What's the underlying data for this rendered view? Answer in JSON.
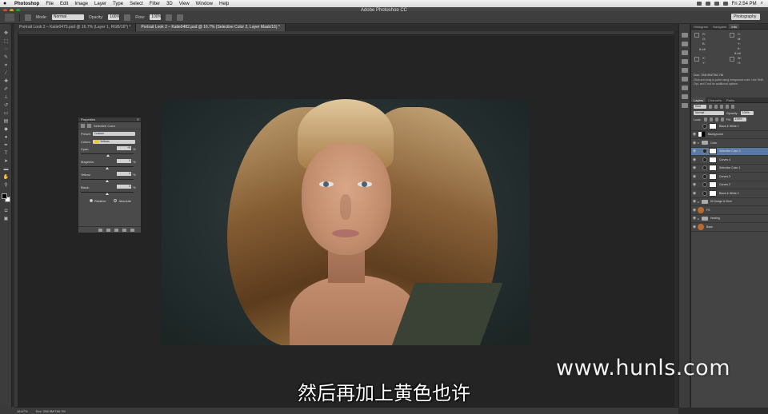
{
  "menubar": {
    "app_name": "Photoshop",
    "menus": [
      "File",
      "Edit",
      "Image",
      "Layer",
      "Type",
      "Select",
      "Filter",
      "3D",
      "View",
      "Window",
      "Help"
    ],
    "clock": "Fri 2:54 PM"
  },
  "window": {
    "title": "Adobe Photoshop CC"
  },
  "options": {
    "mode_label": "Mode:",
    "mode_value": "Normal",
    "opacity_label": "Opacity:",
    "opacity_value": "100%",
    "flow_label": "Flow:",
    "flow_value": "100%",
    "workspace": "Photography"
  },
  "doc_tabs": [
    {
      "label": "Portrait Look 2 – Katie0475.psd @ 16.7% (Layer 1, RGB/16*) *",
      "active": false
    },
    {
      "label": "Portrait Look 2 – Katie0482.psd @ 16.7% (Selective Color 2, Layer Mask/16) *",
      "active": true
    }
  ],
  "properties": {
    "panel_title": "Properties",
    "adjustment_name": "Selective Color",
    "preset_label": "Preset:",
    "preset_value": "Custom",
    "colors_label": "Colors:",
    "colors_value": "Yellows",
    "sliders": [
      {
        "label": "Cyan:",
        "value": "+5",
        "percent": "%",
        "level": 0.52
      },
      {
        "label": "Magenta:",
        "value": "0",
        "percent": "%",
        "level": 0.5
      },
      {
        "label": "Yellow:",
        "value": "0",
        "percent": "%",
        "level": 0.5
      },
      {
        "label": "Black:",
        "value": "0",
        "percent": "%",
        "level": 0.5
      }
    ],
    "relative_label": "Relative",
    "absolute_label": "Absolute"
  },
  "right_top": {
    "tabs": [
      "Histogram",
      "Navigator",
      "Info"
    ],
    "active_tab": "Info",
    "r_label": "R:",
    "g_label": "G:",
    "b_label": "B:",
    "bit_label_1": "8-bit",
    "c_label": "C:",
    "m_label": "M:",
    "y_label": "Y:",
    "k_label": "K:",
    "bit_label_2": "8-bit",
    "x_label": "X:",
    "y2_label": "Y:",
    "w_label": "W:",
    "h_label": "H:",
    "doc_size": "Doc: 258.9M/766.7M",
    "hint": "Click and drag to paint using foreground color. Use Shift, Opt, and Cmd for additional options."
  },
  "layers_panel": {
    "tabs": [
      "Layers",
      "Channels",
      "Paths"
    ],
    "active_tab": "Layers",
    "kind_label": "Kind",
    "blend_mode": "Normal",
    "opacity_label": "Opacity:",
    "opacity_value": "100%",
    "lock_label": "Lock:",
    "fill_label": "Fill:",
    "fill_value": "100%",
    "layers": [
      {
        "name": "Black & White 1",
        "type": "adjust",
        "visible": false,
        "indent": 1,
        "selected": false
      },
      {
        "name": "Background",
        "type": "mask",
        "visible": true,
        "indent": 0,
        "selected": false
      },
      {
        "name": "Color",
        "type": "folder",
        "visible": true,
        "indent": 0,
        "selected": false
      },
      {
        "name": "Selective Color 2",
        "type": "adjust",
        "visible": true,
        "indent": 1,
        "selected": true
      },
      {
        "name": "Curves 4",
        "type": "adjust",
        "visible": true,
        "indent": 1,
        "selected": false
      },
      {
        "name": "Selective Color 1",
        "type": "adjust",
        "visible": true,
        "indent": 1,
        "selected": false
      },
      {
        "name": "Curves 3",
        "type": "adjust",
        "visible": true,
        "indent": 1,
        "selected": false
      },
      {
        "name": "Curves 2",
        "type": "adjust",
        "visible": true,
        "indent": 1,
        "selected": false
      },
      {
        "name": "Black & White 2",
        "type": "adjust",
        "visible": true,
        "indent": 1,
        "selected": false
      },
      {
        "name": "50 Dodge & Burn",
        "type": "folder",
        "visible": true,
        "indent": 0,
        "selected": false
      },
      {
        "name": "FS",
        "type": "photo",
        "visible": true,
        "indent": 0,
        "selected": false
      },
      {
        "name": "Healing",
        "type": "folder",
        "visible": true,
        "indent": 0,
        "selected": false
      },
      {
        "name": "Base",
        "type": "photo",
        "visible": true,
        "indent": 0,
        "selected": false
      }
    ]
  },
  "statusbar": {
    "zoom": "16.67%",
    "doc": "Doc: 258.9M/766.7M"
  },
  "overlay": {
    "watermark": "www.hunls.com",
    "subtitle": "然后再加上黄色也许"
  },
  "colors": {
    "selected_layer": "#5a7aa6",
    "yellow_swatch": "#e5cf26"
  }
}
